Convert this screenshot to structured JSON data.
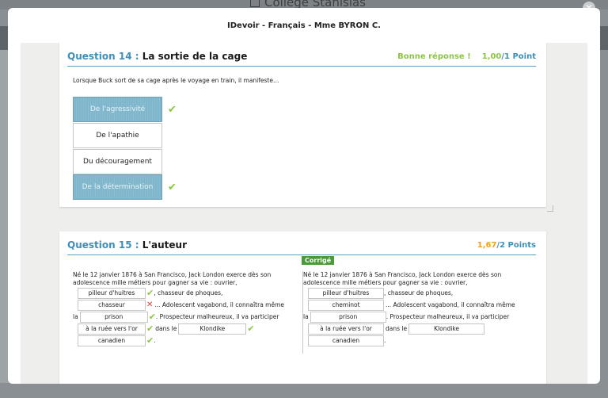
{
  "background": {
    "app_title": "Collège Stanislas"
  },
  "modal": {
    "title": "IDevoir - Français - Mme BYRON C."
  },
  "q14": {
    "label": "Question 14 : ",
    "name": "La sortie de la cage",
    "result": "Bonne réponse !",
    "score": "1,00",
    "total": "/1 Point",
    "prompt": "Lorsque Buck sort de sa cage après le voyage en train, il manifeste…",
    "choices": [
      {
        "text": "De l'agressivité",
        "selected": true,
        "correct": true
      },
      {
        "text": "De l'apathie",
        "selected": false,
        "correct": false
      },
      {
        "text": "Du découragement",
        "selected": false,
        "correct": false
      },
      {
        "text": "De la détermination",
        "selected": true,
        "correct": true
      }
    ]
  },
  "q15": {
    "label": "Question 15 : ",
    "name": "L'auteur",
    "score": "1,67",
    "total": "/2 Points",
    "badge": "Corrigé",
    "intro_1": "Né le 12 janvier 1876 à San Francisco, Jack London exerce dès son",
    "intro_2": "adolescence mille métiers pour gagner sa vie : ouvrier,",
    "after_1": ", chasseur de phoques,",
    "after_2": "... Adolescent vagabond, il connaîtra même",
    "before_3": "la",
    "after_3": ". Prospecteur malheureux, il va participer",
    "after_4": "dans le",
    "after_5": ".",
    "student": [
      "pilleur d'huitres",
      "chasseur",
      "prison",
      "à la ruée vers l'or",
      "Klondike",
      "canadien"
    ],
    "corrected": [
      "pilleur d'huitres",
      "cheminot",
      "prison",
      "à la ruée vers l'or",
      "Klondike",
      "canadien"
    ]
  }
}
